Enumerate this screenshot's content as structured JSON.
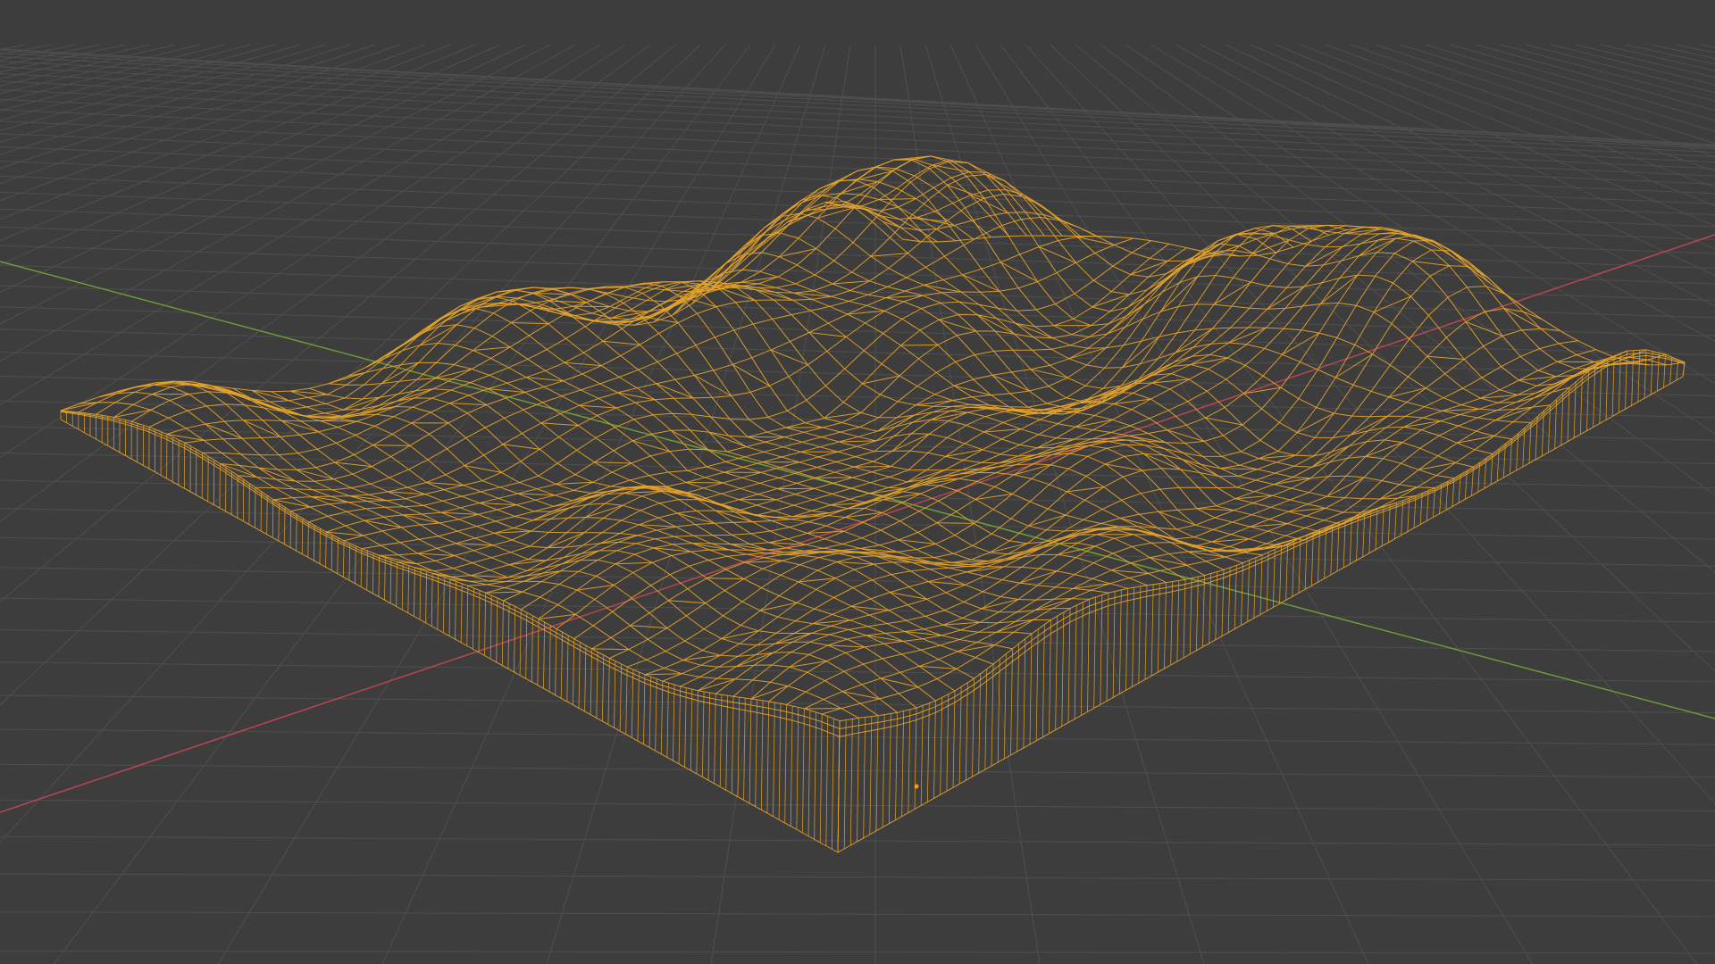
{
  "viewport": {
    "mode": "wireframe",
    "background_color": "#3d3d3d",
    "grid_color": "#4f4f4f",
    "x_axis_color": "#b8474f",
    "y_axis_color": "#6e9a3a",
    "selection_color": "#e8a42a",
    "origin_color": "#ff9a00"
  },
  "object": {
    "type": "terrain-mesh",
    "selected": true,
    "display": "wireframe"
  }
}
